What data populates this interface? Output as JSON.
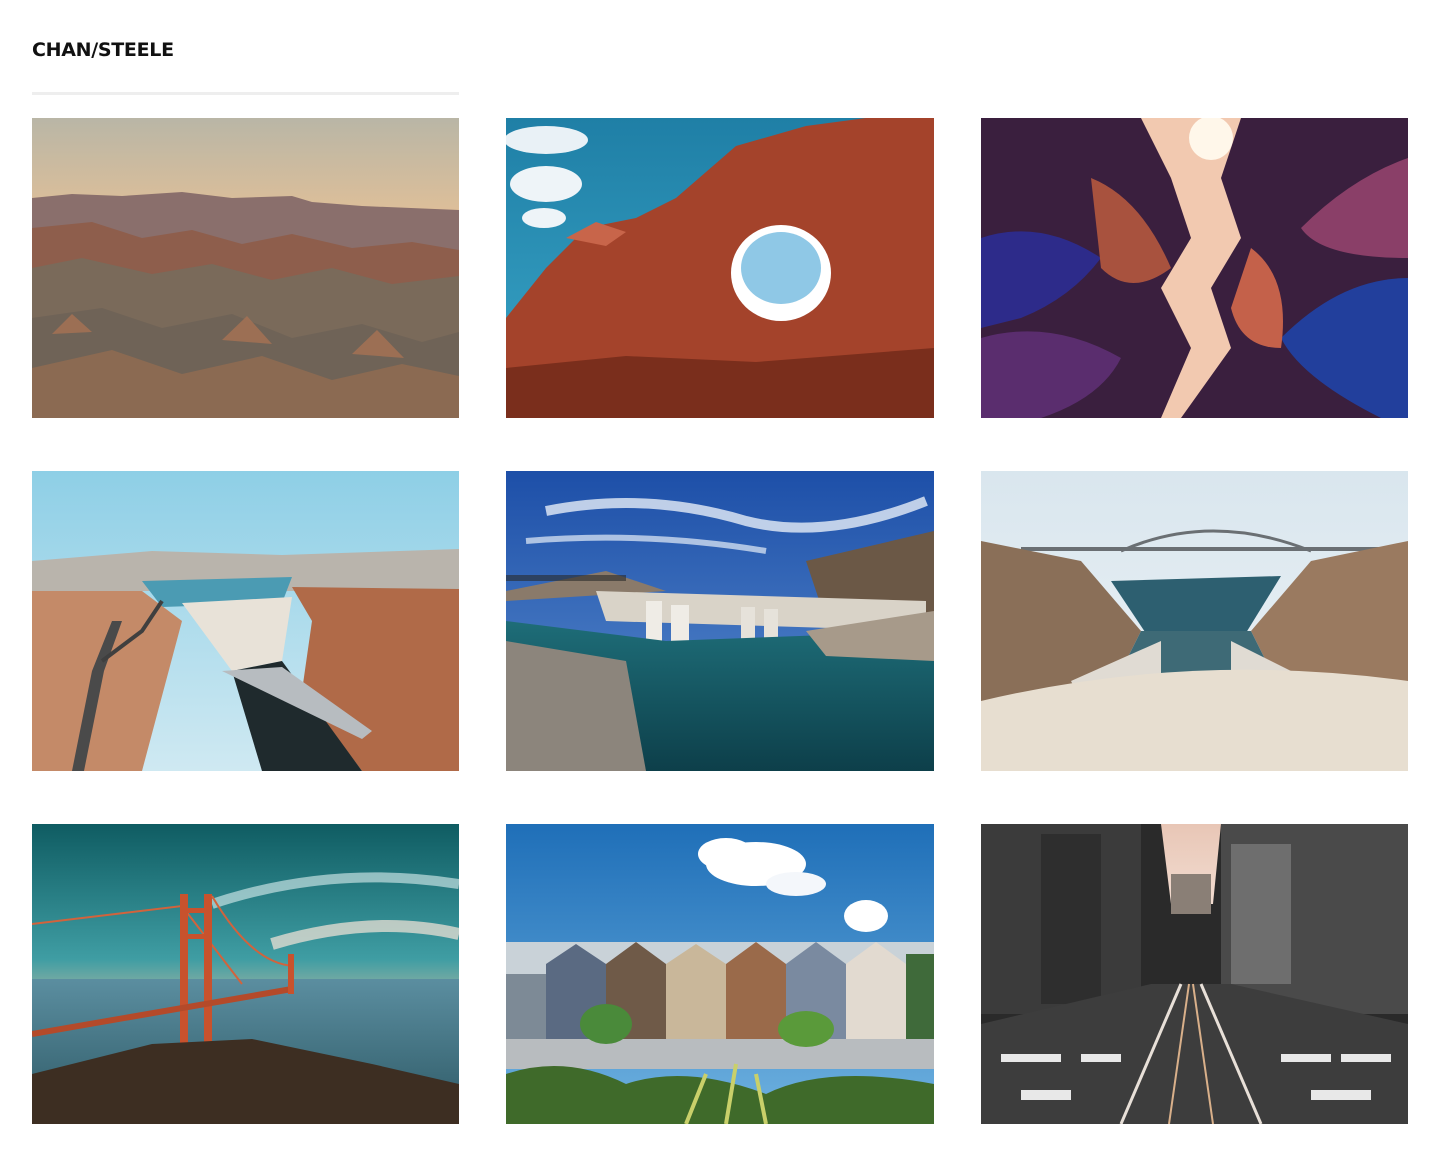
{
  "site": {
    "brand": "CHAN/STEELE"
  },
  "gallery": {
    "photos": [
      {
        "subject": "grand-canyon-sunset"
      },
      {
        "subject": "red-rock-arch"
      },
      {
        "subject": "slot-canyon"
      },
      {
        "subject": "hoover-dam-aerial"
      },
      {
        "subject": "hoover-dam-intake-towers"
      },
      {
        "subject": "hoover-dam-bypass-bridge"
      },
      {
        "subject": "golden-gate-bridge"
      },
      {
        "subject": "painted-ladies-houses"
      },
      {
        "subject": "san-francisco-street"
      }
    ]
  }
}
